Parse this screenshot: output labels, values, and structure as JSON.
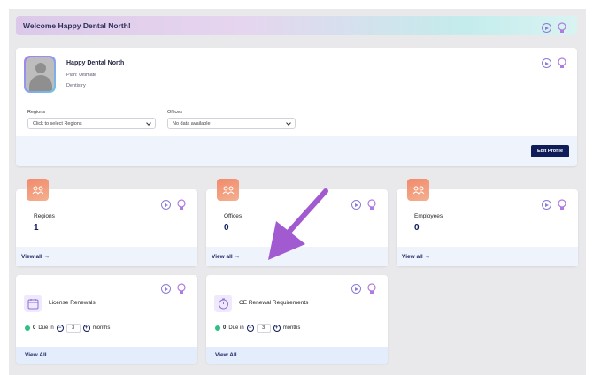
{
  "welcome": {
    "text": "Welcome Happy Dental North!"
  },
  "profile": {
    "name": "Happy Dental North",
    "plan": "Plan: Ultimate",
    "specialty": "Dentistry",
    "regions_label": "Regions",
    "regions_placeholder": "Click to select Regions",
    "offices_label": "Offices",
    "offices_value": "No data available",
    "edit_label": "Edit Profile"
  },
  "stats": [
    {
      "title": "Regions",
      "value": "1",
      "link": "View all →"
    },
    {
      "title": "Offices",
      "value": "0",
      "link": "View all →"
    },
    {
      "title": "Employees",
      "value": "0",
      "link": "View all →"
    }
  ],
  "renewals": [
    {
      "title": "License Renewals",
      "due_count": "0",
      "due_text": "Due in",
      "months_value": "3",
      "months_text": "months",
      "link": "View All",
      "icon": "calendar-icon"
    },
    {
      "title": "CE Renewal Requirements",
      "due_count": "0",
      "due_text": "Due in",
      "months_value": "3",
      "months_text": "months",
      "link": "View All",
      "icon": "timer-icon"
    }
  ],
  "colors": {
    "accent": "#0f1c5a",
    "badge": "#f08a6a",
    "annotation_arrow": "#a25ad0",
    "status_green": "#2fbf86"
  }
}
